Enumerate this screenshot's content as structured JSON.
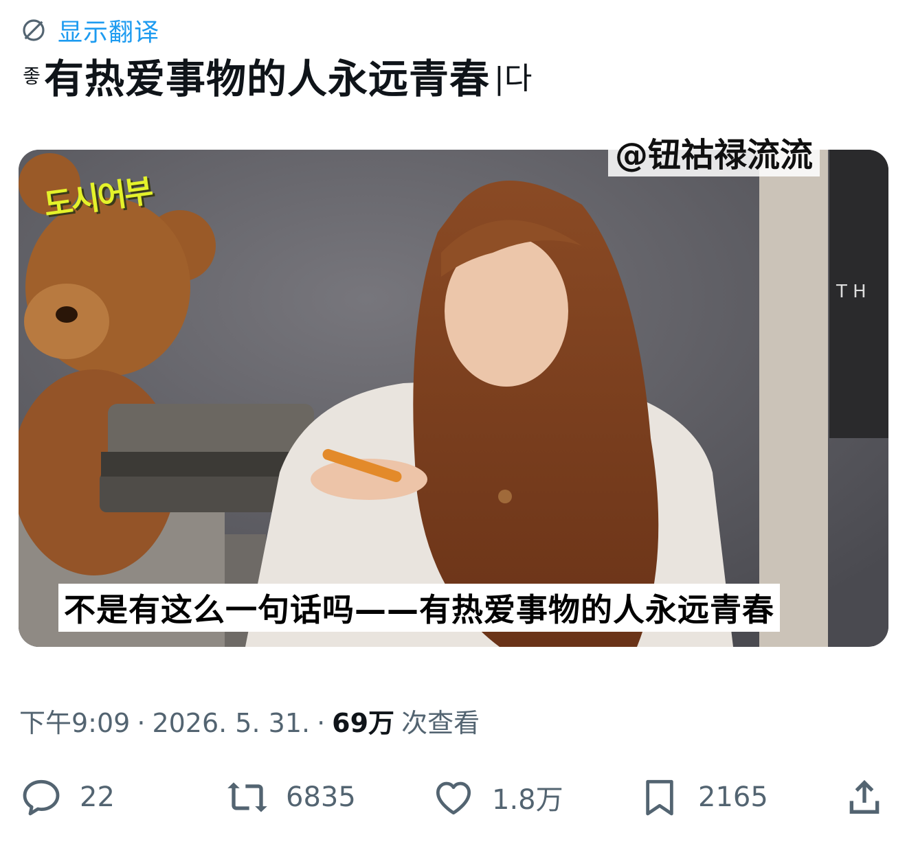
{
  "translate": {
    "label": "显示翻译",
    "icon": "globe-slash-icon"
  },
  "post": {
    "prefix": "좋",
    "text": "有热爱事物的人永远青春",
    "suffix": "|다"
  },
  "media": {
    "show_logo": "도시어부",
    "watermark": "@钮祜禄流流",
    "subtitle": "不是有这么一句话吗——有热爱事物的人永远青春"
  },
  "meta": {
    "time": "下午9:09",
    "sep1": "·",
    "date": "2026. 5. 31.",
    "sep2": "·",
    "views_count": "69万",
    "views_label": "次查看"
  },
  "actions": {
    "reply": {
      "icon": "reply-icon",
      "count": "22"
    },
    "repost": {
      "icon": "repost-icon",
      "count": "6835"
    },
    "like": {
      "icon": "heart-icon",
      "count": "1.8万"
    },
    "bookmark": {
      "icon": "bookmark-icon",
      "count": "2165"
    },
    "share": {
      "icon": "share-icon"
    }
  },
  "colors": {
    "link": "#1d9bf0",
    "muted": "#536471",
    "text": "#0f1419"
  }
}
